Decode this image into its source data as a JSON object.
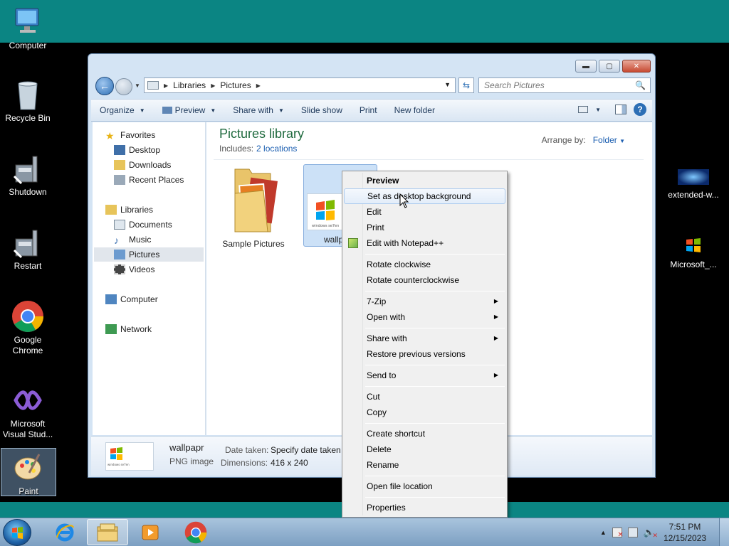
{
  "desktop": {
    "icons_left": [
      {
        "label": "Computer",
        "icon": "computer-icon"
      },
      {
        "label": "Recycle Bin",
        "icon": "recycle-bin-icon"
      },
      {
        "label": "Shutdown",
        "icon": "shutdown-icon"
      },
      {
        "label": "Restart",
        "icon": "restart-icon"
      },
      {
        "label": "Google Chrome",
        "icon": "chrome-icon"
      },
      {
        "label": "Microsoft Visual Stud...",
        "icon": "visual-studio-icon"
      },
      {
        "label": "Paint",
        "icon": "paint-icon"
      }
    ],
    "icons_right": [
      {
        "label": "extended-w...",
        "icon": "image-file-icon"
      },
      {
        "label": "Microsoft_...",
        "icon": "windows-flag-icon"
      }
    ]
  },
  "window": {
    "address": {
      "crumbs": [
        "Libraries",
        "Pictures"
      ]
    },
    "search_placeholder": "Search Pictures",
    "toolbar": {
      "organize": "Organize",
      "preview": "Preview",
      "share_with": "Share with",
      "slide_show": "Slide show",
      "print": "Print",
      "new_folder": "New folder"
    },
    "nav": {
      "favorites": "Favorites",
      "desktop": "Desktop",
      "downloads": "Downloads",
      "recent_places": "Recent Places",
      "libraries": "Libraries",
      "documents": "Documents",
      "music": "Music",
      "pictures": "Pictures",
      "videos": "Videos",
      "computer": "Computer",
      "network": "Network"
    },
    "library": {
      "title": "Pictures library",
      "includes_label": "Includes:",
      "includes_link": "2 locations",
      "arrange_label": "Arrange by:",
      "arrange_value": "Folder"
    },
    "files": [
      {
        "name": "Sample Pictures",
        "icon": "folder-icon"
      },
      {
        "name": "wallp",
        "icon": "png-thumbnail-icon"
      }
    ],
    "details": {
      "name": "wallpapr",
      "type": "PNG image",
      "date_label": "Date taken:",
      "date_value": "Specify date taken",
      "dim_label": "Dimensions:",
      "dim_value": "416 x 240"
    }
  },
  "context_menu": {
    "items": [
      {
        "label": "Preview",
        "bold": true
      },
      {
        "label": "Set as desktop background",
        "hover": true
      },
      {
        "label": "Edit"
      },
      {
        "label": "Print"
      },
      {
        "label": "Edit with Notepad++"
      },
      {
        "label": "Rotate clockwise"
      },
      {
        "label": "Rotate counterclockwise"
      },
      {
        "label": "7-Zip",
        "submenu": true
      },
      {
        "label": "Open with",
        "submenu": true
      },
      {
        "label": "Share with",
        "submenu": true
      },
      {
        "label": "Restore previous versions"
      },
      {
        "label": "Send to",
        "submenu": true
      },
      {
        "label": "Cut"
      },
      {
        "label": "Copy"
      },
      {
        "label": "Create shortcut"
      },
      {
        "label": "Delete"
      },
      {
        "label": "Rename"
      },
      {
        "label": "Open file location"
      },
      {
        "label": "Properties"
      }
    ]
  },
  "taskbar": {
    "clock_time": "7:51 PM",
    "clock_date": "12/15/2023"
  },
  "colors": {
    "desktop_teal": "#0b8583",
    "library_title": "#1f6a3e",
    "link_blue": "#1c5fb1"
  }
}
